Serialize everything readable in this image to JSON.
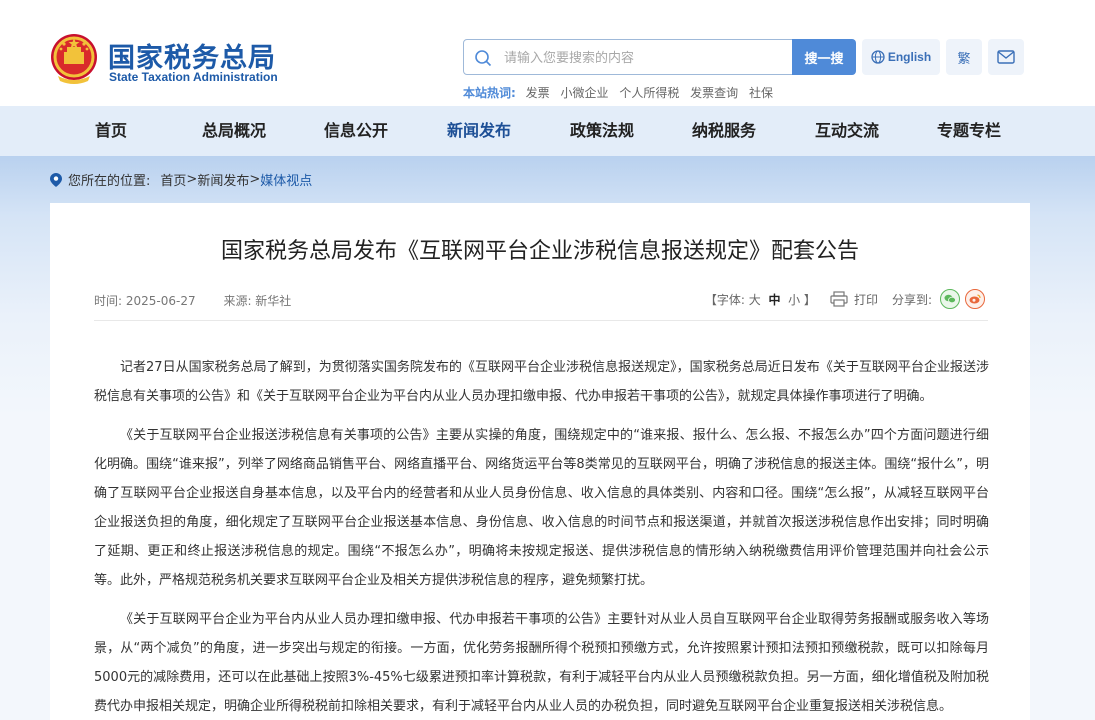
{
  "header": {
    "logo_cn": "国家税务总局",
    "logo_en": "State Taxation Administration",
    "search": {
      "placeholder": "请输入您要搜索的内容",
      "button": "搜一搜"
    },
    "hot": {
      "label": "本站热词:",
      "items": [
        "发票",
        "小微企业",
        "个人所得税",
        "发票查询",
        "社保"
      ]
    },
    "english": "English",
    "traditional": "繁"
  },
  "nav": {
    "items": [
      "首页",
      "总局概况",
      "信息公开",
      "新闻发布",
      "政策法规",
      "纳税服务",
      "互动交流",
      "专题专栏"
    ],
    "active": "新闻发布"
  },
  "breadcrumb": {
    "prefix": "您所在的位置:",
    "home": "首页",
    "sep": ">",
    "level1": "新闻发布",
    "current": "媒体视点"
  },
  "article": {
    "title": "国家税务总局发布《互联网平台企业涉税信息报送规定》配套公告",
    "time": "时间: 2025-06-27",
    "source": "来源: 新华社",
    "font_label": "【字体: ",
    "font_large": "大",
    "font_medium": "中",
    "font_small": "小",
    "font_end": " 】",
    "print": "打印",
    "share": "分享到:",
    "paragraphs": [
      "记者27日从国家税务总局了解到，为贯彻落实国务院发布的《互联网平台企业涉税信息报送规定》，国家税务总局近日发布《关于互联网平台企业报送涉税信息有关事项的公告》和《关于互联网平台企业为平台内从业人员办理扣缴申报、代办申报若干事项的公告》，就规定具体操作事项进行了明确。",
      "《关于互联网平台企业报送涉税信息有关事项的公告》主要从实操的角度，围绕规定中的“谁来报、报什么、怎么报、不报怎么办”四个方面问题进行细化明确。围绕“谁来报”，列举了网络商品销售平台、网络直播平台、网络货运平台等8类常见的互联网平台，明确了涉税信息的报送主体。围绕“报什么”，明确了互联网平台企业报送自身基本信息，以及平台内的经营者和从业人员身份信息、收入信息的具体类别、内容和口径。围绕“怎么报”，从减轻互联网平台企业报送负担的角度，细化规定了互联网平台企业报送基本信息、身份信息、收入信息的时间节点和报送渠道，并就首次报送涉税信息作出安排；同时明确了延期、更正和终止报送涉税信息的规定。围绕“不报怎么办”，明确将未按规定报送、提供涉税信息的情形纳入纳税缴费信用评价管理范围并向社会公示等。此外，严格规范税务机关要求互联网平台企业及相关方提供涉税信息的程序，避免频繁打扰。",
      "《关于互联网平台企业为平台内从业人员办理扣缴申报、代办申报若干事项的公告》主要针对从业人员自互联网平台企业取得劳务报酬或服务收入等场景，从“两个减负”的角度，进一步突出与规定的衔接。一方面，优化劳务报酬所得个税预扣预缴方式，允许按照累计预扣法预扣预缴税款，既可以扣除每月5000元的减除费用，还可以在此基础上按照3%-45%七级累进预扣率计算税款，有利于减轻平台内从业人员预缴税款负担。另一方面，细化增值税及附加税费代办申报相关规定，明确企业所得税税前扣除相关要求，有利于减轻平台内从业人员的办税负担，同时避免互联网平台企业重复报送相关涉税信息。"
    ]
  }
}
